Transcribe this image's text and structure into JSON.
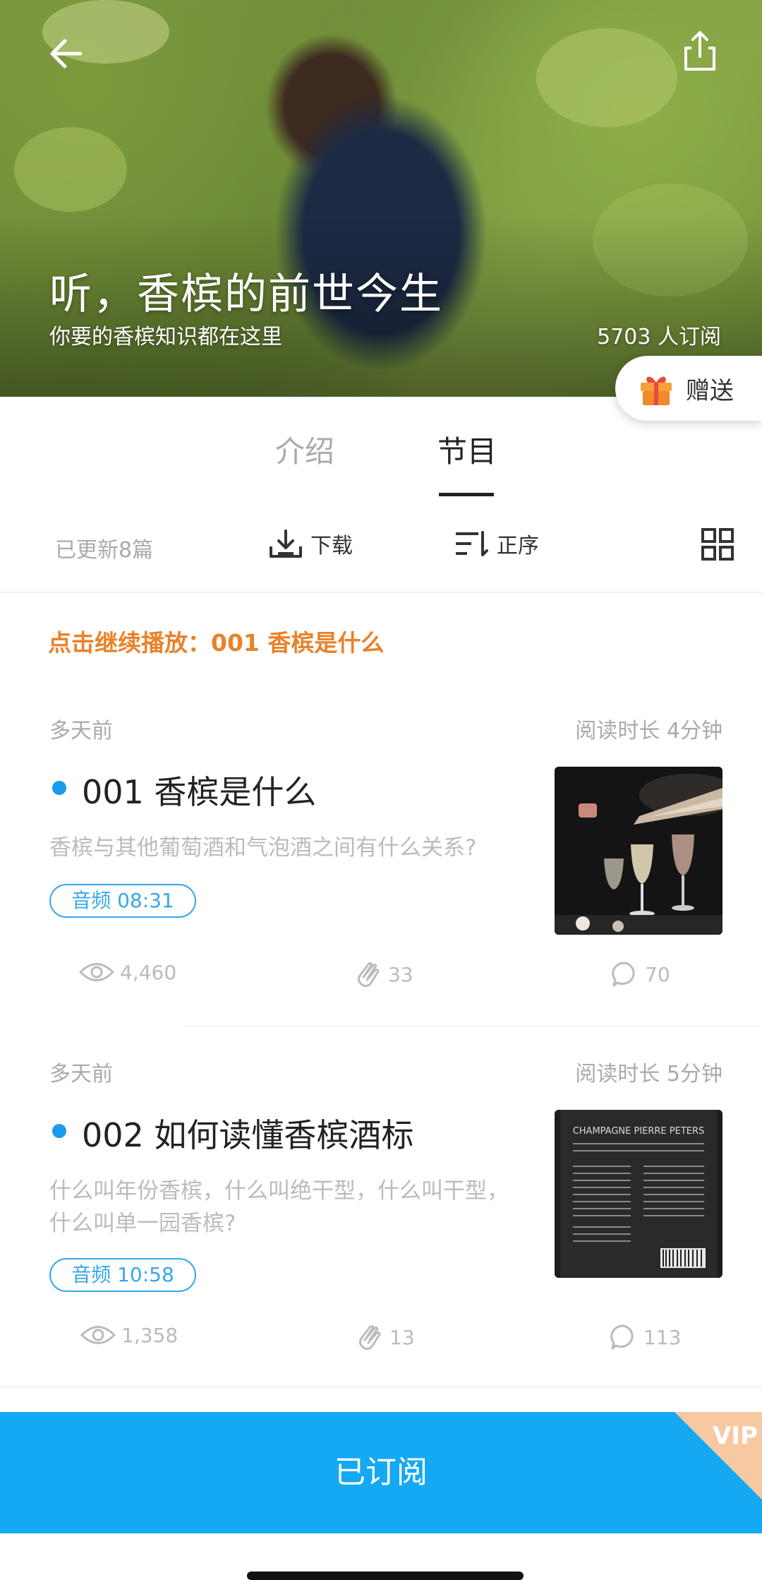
{
  "header": {
    "title": "听，香槟的前世今生",
    "subtitle": "你要的香槟知识都在这里",
    "subscribers": "5703 人订阅",
    "gift_label": "赠送"
  },
  "tabs": [
    {
      "label": "介绍",
      "active": false
    },
    {
      "label": "节目",
      "active": true
    }
  ],
  "toolbar": {
    "updated": "已更新8篇",
    "download_label": "下载",
    "sort_label": "正序"
  },
  "continue_play": "点击继续播放：001 香槟是什么",
  "episodes": [
    {
      "date": "多天前",
      "duration": "阅读时长 4分钟",
      "title": "001 香槟是什么",
      "description": "香槟与其他葡萄酒和气泡酒之间有什么关系?",
      "audio": "音频 08:31",
      "views": "4,460",
      "likes": "33",
      "comments": "70"
    },
    {
      "date": "多天前",
      "duration": "阅读时长 5分钟",
      "title": "002 如何读懂香槟酒标",
      "description_line1": "什么叫年份香槟，什么叫绝干型，什么叫干型，",
      "description_line2": "什么叫单一园香槟?",
      "audio": "音频 10:58",
      "views": "1,358",
      "likes": "13",
      "comments": "113",
      "label_text": "CHAMPAGNE PIERRE PETERS"
    }
  ],
  "bottom": {
    "subscribe_label": "已订阅",
    "vip_label": "VIP"
  },
  "colors": {
    "accent_blue": "#15a8f3",
    "continue_orange": "#e8822a",
    "badge_blue": "#36a7e9"
  }
}
